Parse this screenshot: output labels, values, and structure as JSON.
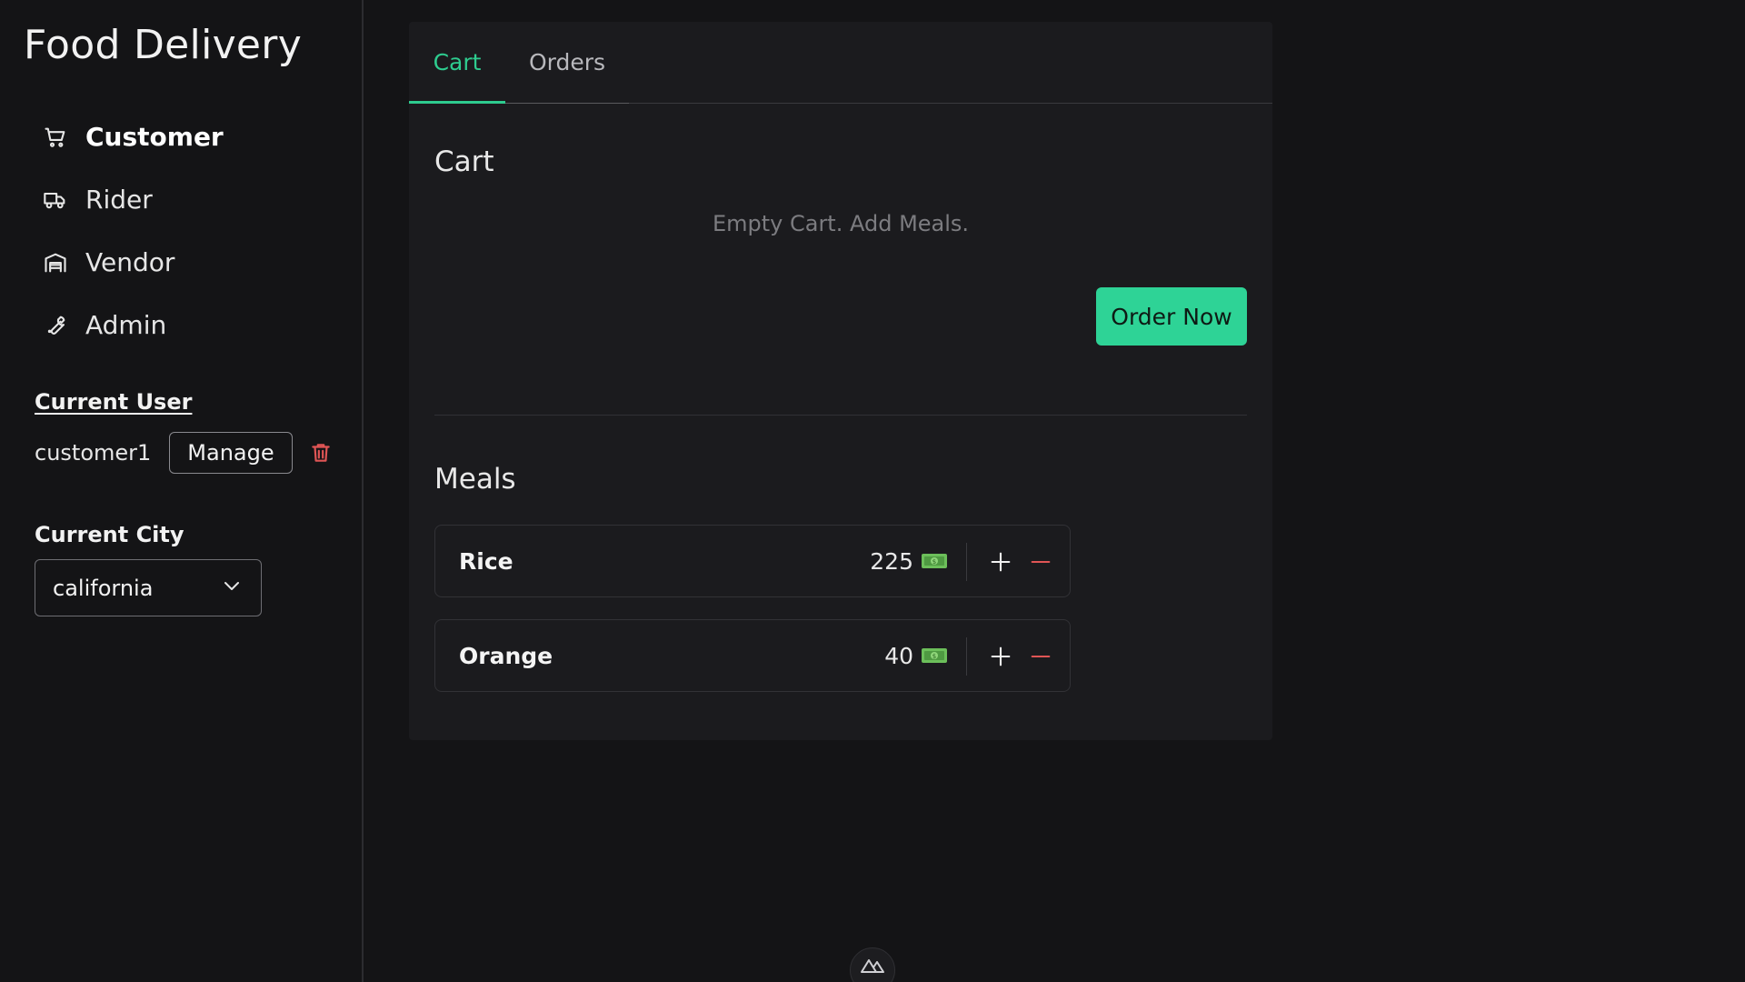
{
  "app": {
    "title": "Food Delivery"
  },
  "sidebar": {
    "nav": [
      {
        "label": "Customer",
        "icon": "cart-icon",
        "active": true
      },
      {
        "label": "Rider",
        "icon": "truck-icon",
        "active": false
      },
      {
        "label": "Vendor",
        "icon": "warehouse-icon",
        "active": false
      },
      {
        "label": "Admin",
        "icon": "wrench-icon",
        "active": false
      }
    ],
    "current_user_label": "Current User",
    "username": "customer1",
    "manage_label": "Manage",
    "current_city_label": "Current City",
    "city_selected": "california"
  },
  "tabs": [
    {
      "label": "Cart",
      "active": true
    },
    {
      "label": "Orders",
      "active": false
    }
  ],
  "cart": {
    "heading": "Cart",
    "empty_message": "Empty Cart. Add Meals.",
    "order_button": "Order Now"
  },
  "meals": {
    "heading": "Meals",
    "items": [
      {
        "name": "Rice",
        "price": "225"
      },
      {
        "name": "Orange",
        "price": "40"
      }
    ]
  },
  "colors": {
    "accent": "#2ecc8f",
    "danger": "#e05555",
    "background": "#141416",
    "card": "#1b1b1e"
  }
}
